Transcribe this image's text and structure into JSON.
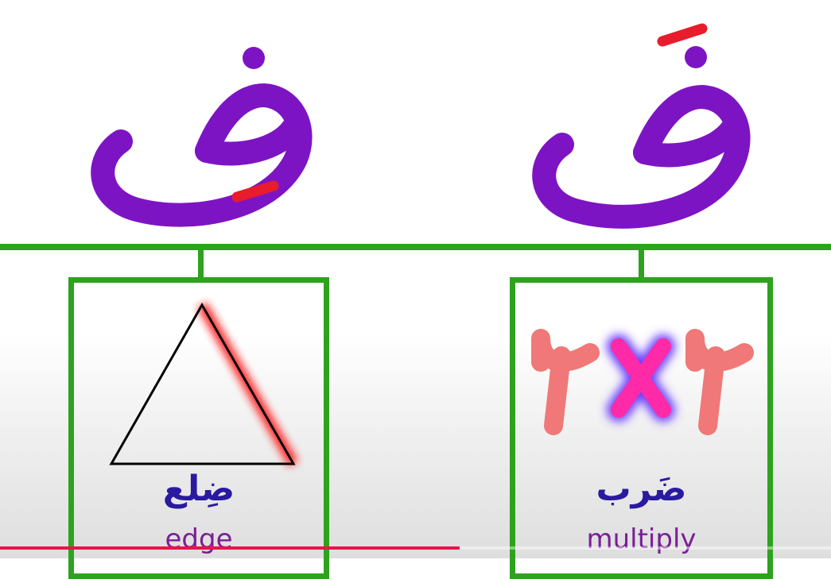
{
  "letters": {
    "fatha": {
      "glyph": "ضَ",
      "letter_color": "#7d14c4",
      "mark_color": "#e81c2c"
    },
    "kasra": {
      "glyph": "ضِ",
      "letter_color": "#7d14c4",
      "mark_color": "#e81c2c"
    }
  },
  "cards": {
    "right": {
      "picture": "multiplication-2x2",
      "equation": "٢×٢",
      "word_ar": "ضَرب",
      "word_en": "multiply"
    },
    "left": {
      "picture": "triangle-edge",
      "word_ar": "ضِلع",
      "word_en": "edge"
    }
  },
  "colors": {
    "line": "#2ea21e",
    "arabic_word": "#2a1aa0",
    "english_word": "#7a1f96",
    "digits": "#f07878",
    "times": "#ff2aa8"
  },
  "video": {
    "progress": 0.553
  }
}
